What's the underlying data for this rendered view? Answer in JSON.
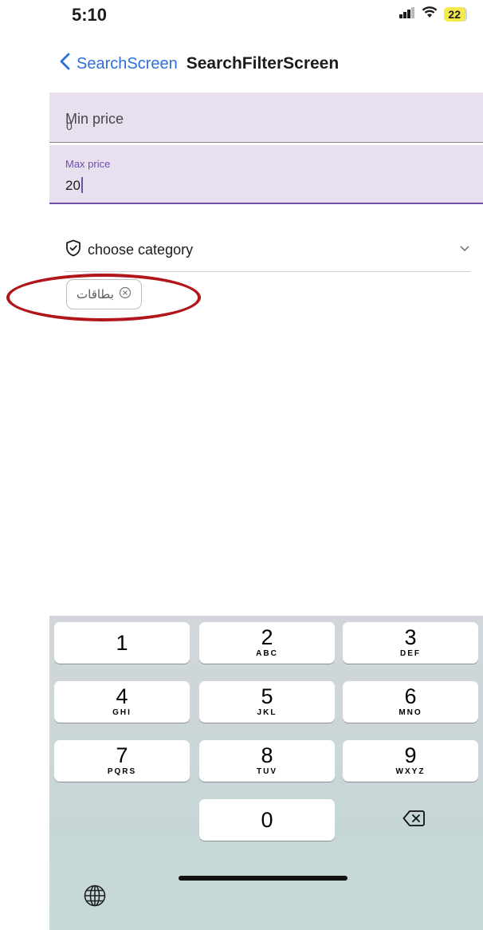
{
  "status_bar": {
    "time": "5:10",
    "battery": "22"
  },
  "nav": {
    "back_label": "SearchScreen",
    "title": "SearchFilterScreen"
  },
  "min_price": {
    "label": "Min price",
    "value": "0"
  },
  "max_price": {
    "label": "Max price",
    "value": "20"
  },
  "category": {
    "placeholder": "choose category"
  },
  "selected_chip": {
    "label": "بطاقات"
  },
  "keypad": {
    "keys": [
      {
        "num": "1",
        "letters": ""
      },
      {
        "num": "2",
        "letters": "ABC"
      },
      {
        "num": "3",
        "letters": "DEF"
      },
      {
        "num": "4",
        "letters": "GHI"
      },
      {
        "num": "5",
        "letters": "JKL"
      },
      {
        "num": "6",
        "letters": "MNO"
      },
      {
        "num": "7",
        "letters": "PQRS"
      },
      {
        "num": "8",
        "letters": "TUV"
      },
      {
        "num": "9",
        "letters": "WXYZ"
      },
      {
        "num": "0",
        "letters": ""
      }
    ]
  },
  "colors": {
    "accent": "#6d50a8",
    "link": "#2f6fd8",
    "field_bg": "#e9e0ef",
    "highlight": "#b1161b"
  },
  "icons": [
    "signal-icon",
    "wifi-icon",
    "back-chevron-icon",
    "shield-check-icon",
    "chevron-down-icon",
    "close-circle-icon",
    "backspace-icon",
    "globe-icon"
  ]
}
